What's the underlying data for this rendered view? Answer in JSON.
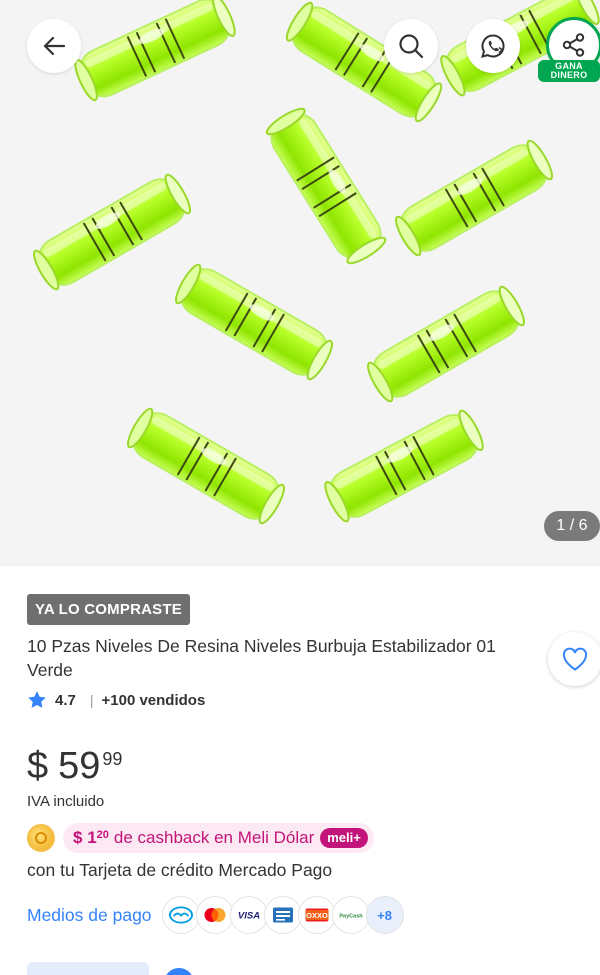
{
  "gallery": {
    "counter": "1 / 6",
    "earn_badge": [
      "GANA",
      "DINERO"
    ]
  },
  "icons": {
    "back": "arrow-left-icon",
    "search": "search-icon",
    "whatsapp": "whatsapp-icon",
    "share": "share-icon",
    "favorite": "heart-icon",
    "star": "star-icon"
  },
  "product": {
    "tag": "YA LO COMPRASTE",
    "title": "10 Pzas Niveles De Resina Niveles Burbuja Estabilizador 01 Verde",
    "rating": "4.7",
    "separator": "|",
    "sold": "+100 vendidos"
  },
  "price": {
    "currency": "$",
    "amount": "59",
    "cents": "99",
    "tax_note": "IVA incluido"
  },
  "cashback": {
    "currency": "$",
    "amount": "1",
    "amount_cents": "20",
    "text": "de cashback en Meli Dólar",
    "badge": "meli+"
  },
  "card_line": "con tu Tarjeta de crédito Mercado Pago",
  "payment": {
    "link": "Medios de pago",
    "methods": [
      "mercado-pago",
      "mastercard",
      "visa",
      "amex",
      "oxxo",
      "paycash"
    ],
    "visa_label": "VISA",
    "oxxo_label": "OXXO",
    "paycash_label": "PayCash",
    "more": "+8"
  },
  "colors": {
    "accent_blue": "#3483fa",
    "earn_green": "#00a650",
    "cashback_pink": "#c2147a",
    "tag_gray": "#6f6f6f",
    "level_green": "#a8ff1a"
  }
}
